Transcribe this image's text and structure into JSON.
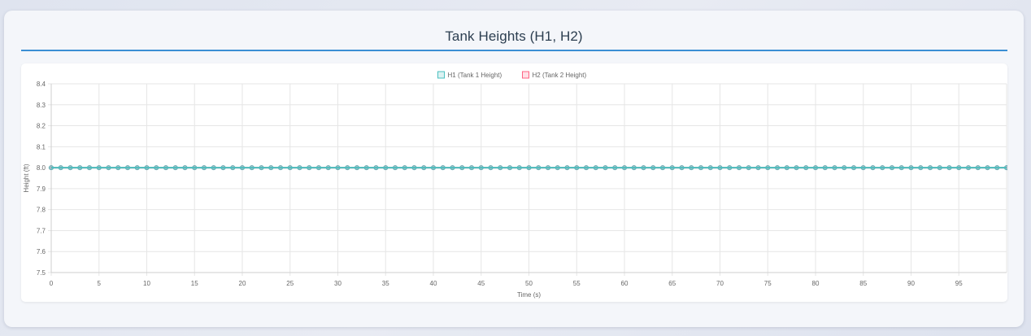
{
  "page": {
    "title": "Tank Heights (H1, H2)"
  },
  "colors": {
    "accent": "#3a8fd4",
    "h1": "#4bc0c0",
    "h2": "#ff6384"
  },
  "chart_data": {
    "type": "line",
    "title": "",
    "xlabel": "Time (s)",
    "ylabel": "Height (ft)",
    "ylim": [
      7.5,
      8.4
    ],
    "xlim": [
      0,
      100
    ],
    "yticks": [
      7.5,
      7.6,
      7.7,
      7.8,
      7.9,
      8.0,
      8.1,
      8.2,
      8.3,
      8.4
    ],
    "ytick_labels": [
      "7.5",
      "7.6",
      "7.7",
      "7.8",
      "7.9",
      "8.0",
      "8.1",
      "8.2",
      "8.3",
      "8.4"
    ],
    "xticks": [
      0,
      5,
      10,
      15,
      20,
      25,
      30,
      35,
      40,
      45,
      50,
      55,
      60,
      65,
      70,
      75,
      80,
      85,
      90,
      95
    ],
    "xtick_labels": [
      "0",
      "5",
      "10",
      "15",
      "20",
      "25",
      "30",
      "35",
      "40",
      "45",
      "50",
      "55",
      "60",
      "65",
      "70",
      "75",
      "80",
      "85",
      "90",
      "95"
    ],
    "grid": true,
    "legend_position": "top",
    "series": [
      {
        "name": "H1 (Tank 1 Height)",
        "color": "#4bc0c0",
        "x_start": 0,
        "x_end": 100,
        "x_step": 1,
        "value": 8.0
      },
      {
        "name": "H2 (Tank 2 Height)",
        "color": "#ff6384",
        "x_start": 0,
        "x_end": 100,
        "x_step": 1,
        "value": 8.0
      }
    ]
  }
}
